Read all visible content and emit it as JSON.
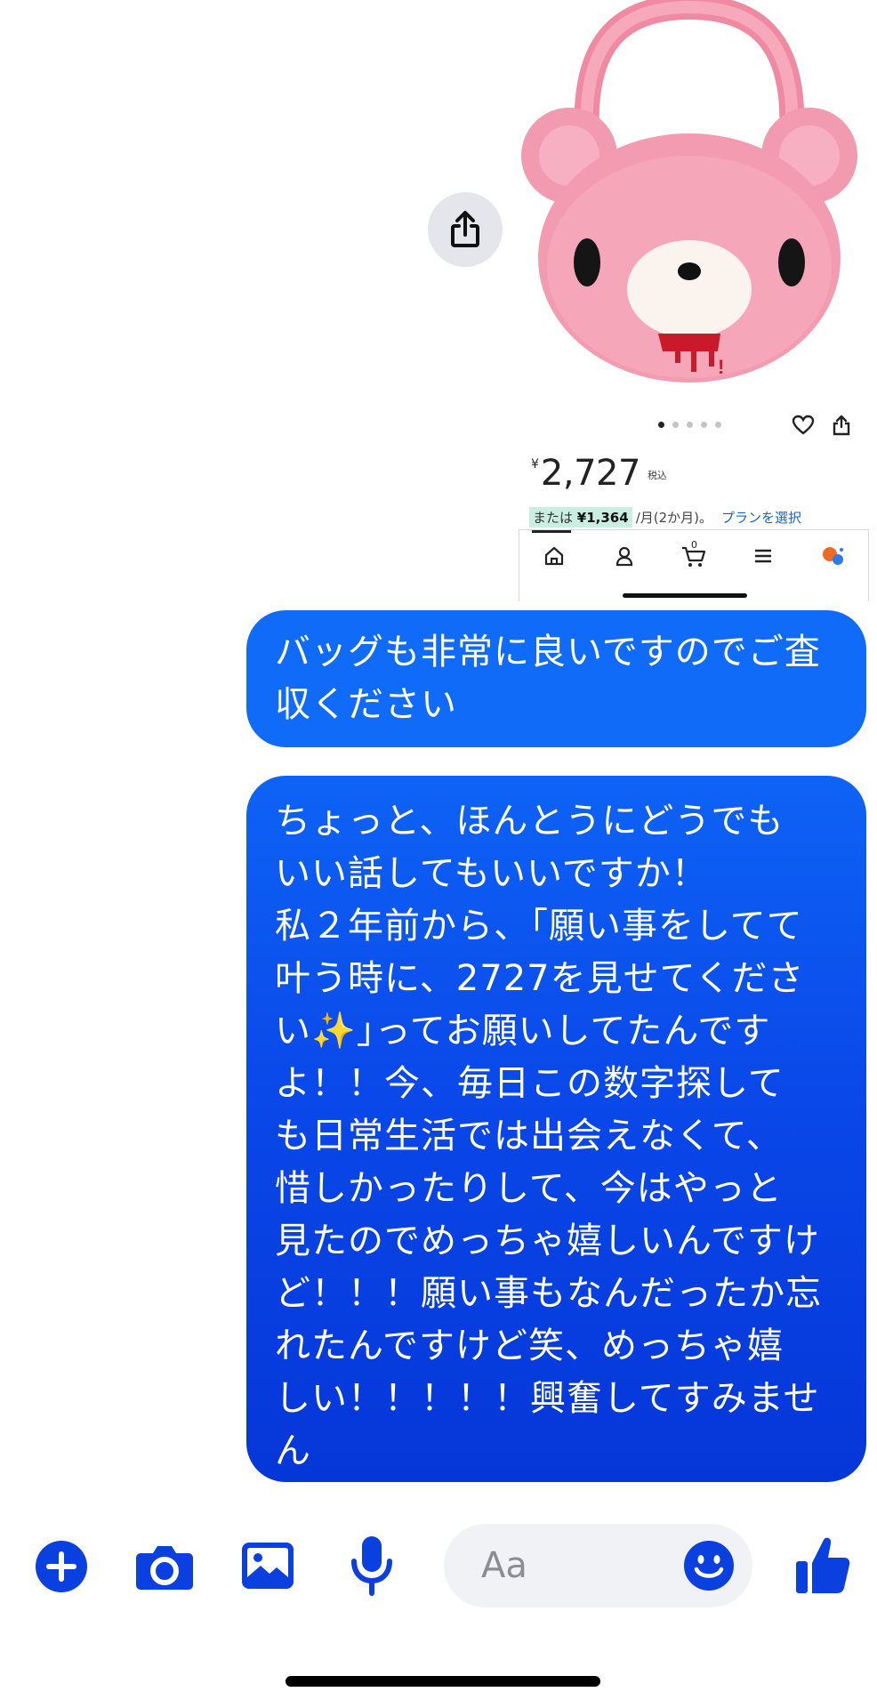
{
  "shared_image": {
    "price_currency": "¥",
    "price": "2,727",
    "tax_label": "税込",
    "installment_prefix": "または",
    "installment_amount": "¥1,364",
    "installment_suffix": "/月(2か月)。",
    "plan_link": "プランを選択",
    "carousel_dots": 5,
    "cart_count": "0"
  },
  "messages": [
    {
      "sender": "me",
      "text": "バッグも非常に良いですのでご査\n収ください"
    },
    {
      "sender": "me",
      "text": "ちょっと、ほんとうにどうでも\nいい話してもいいですか！\n私２年前から、｢願い事をしてて\n叶う時に、2727を見せてくださ\nい✨｣ってお願いしてたんです\nよ！！今、毎日この数字探して\nも日常生活では出会えなくて、\n惜しかったりして、今はやっと\n見たのでめっちゃ嬉しいんですけ\nど！！！願い事もなんだったか忘\nれたんですけど笑、めっちゃ嬉\nしい！！！！！興奮してすみません\nー！！！"
    }
  ],
  "composer": {
    "placeholder": "Aa"
  },
  "colors": {
    "accent": "#0a3fe0",
    "bubble_top": "#0e63f6",
    "bubble_bottom": "#0536d8",
    "bear_pink": "#f39bb0"
  }
}
